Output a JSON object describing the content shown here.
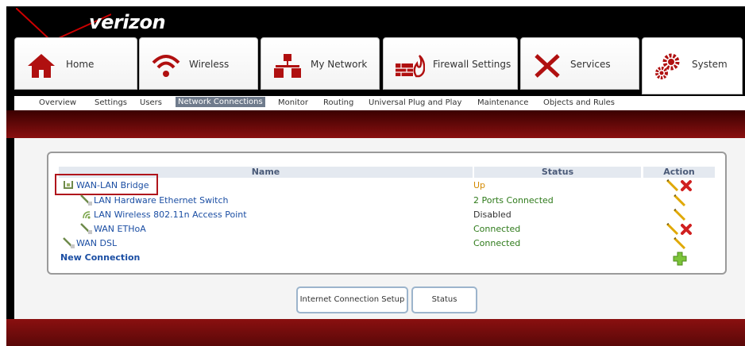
{
  "brand": {
    "logo_text": "verizon",
    "accent": "#cc0000"
  },
  "main_tabs": [
    {
      "label": "Home",
      "icon": "home-icon"
    },
    {
      "label": "Wireless",
      "icon": "wireless-icon"
    },
    {
      "label": "My Network",
      "icon": "network-icon"
    },
    {
      "label": "Firewall Settings",
      "icon": "firewall-icon"
    },
    {
      "label": "Services",
      "icon": "tools-icon"
    },
    {
      "label": "System",
      "icon": "gears-icon"
    }
  ],
  "sub_tabs": [
    "Overview",
    "Settings",
    "Users",
    "Network Connections",
    "Monitor",
    "Routing",
    "Universal Plug and Play",
    "Maintenance",
    "Objects and Rules"
  ],
  "active_sub_tab": "Network Connections",
  "table": {
    "headers": {
      "name": "Name",
      "status": "Status",
      "action": "Action"
    },
    "rows": [
      {
        "name": "WAN-LAN Bridge",
        "status": "Up",
        "status_color": "#d38a00"
      },
      {
        "name": "LAN Hardware Ethernet Switch",
        "status": "2 Ports Connected",
        "status_color": "#2e7a1a"
      },
      {
        "name": "LAN Wireless 802.11n Access Point",
        "status": "Disabled",
        "status_color": "#333333"
      },
      {
        "name": "WAN ETHoA",
        "status": "Connected",
        "status_color": "#2e7a1a"
      },
      {
        "name": "WAN DSL",
        "status": "Connected",
        "status_color": "#2e7a1a"
      }
    ],
    "new_connection": "New Connection"
  },
  "buttons": {
    "setup": "Internet Connection Setup",
    "status": "Status"
  }
}
